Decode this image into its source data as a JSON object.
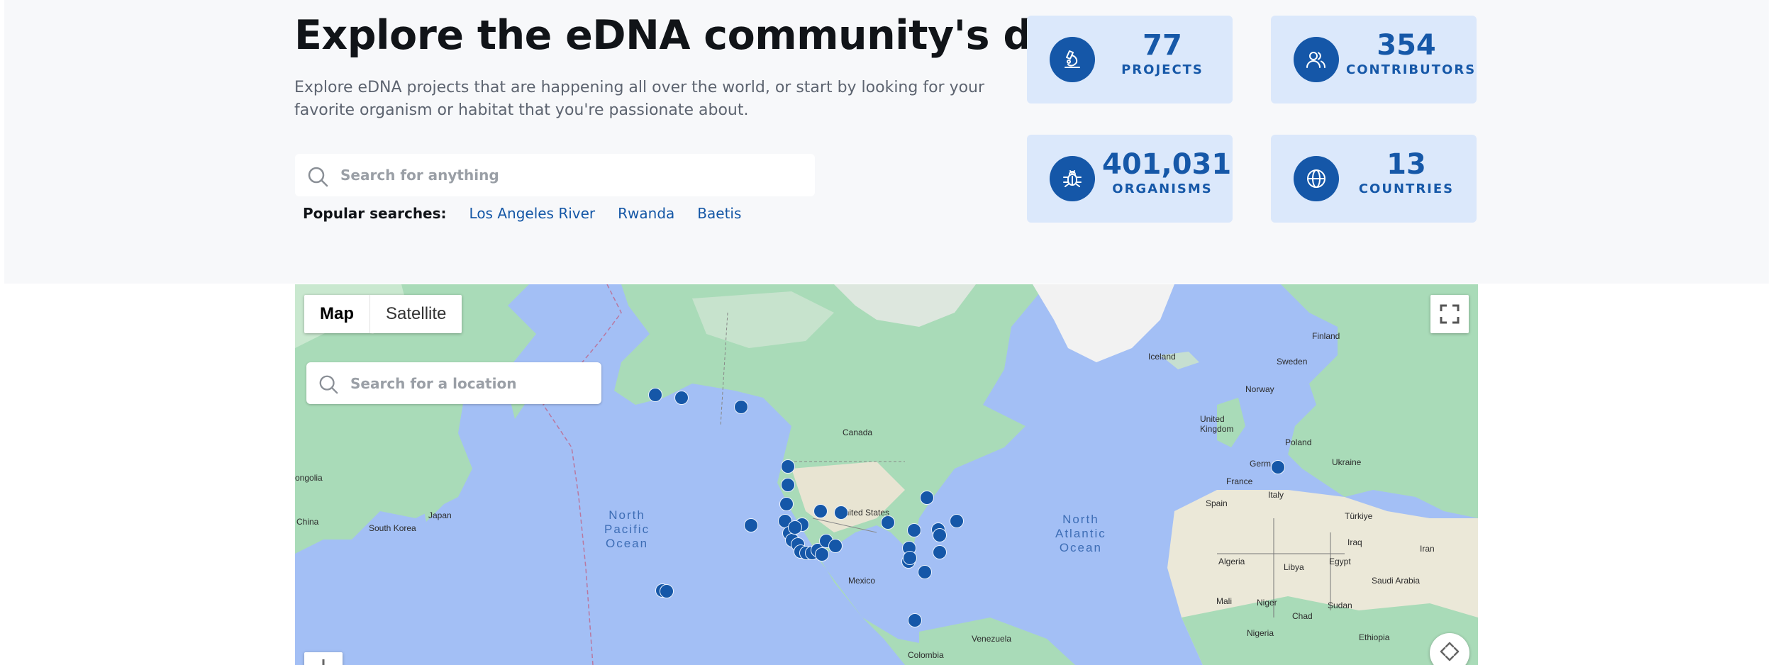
{
  "hero": {
    "title": "Explore the eDNA community's data",
    "subtitle": "Explore eDNA projects that are happening all over the world, or start by looking for your favorite organism or habitat that you're passionate about.",
    "search_placeholder": "Search for anything",
    "popular_label": "Popular searches:",
    "popular_links": [
      "Los Angeles River",
      "Rwanda",
      "Baetis"
    ]
  },
  "stats": [
    {
      "icon": "microscope-icon",
      "value": "77",
      "label": "PROJECTS"
    },
    {
      "icon": "users-icon",
      "value": "354",
      "label": "CONTRIBUTORS"
    },
    {
      "icon": "bug-icon",
      "value": "401,031",
      "label": "ORGANISMS"
    },
    {
      "icon": "globe-icon",
      "value": "13",
      "label": "COUNTRIES"
    }
  ],
  "colors": {
    "accent": "#1557a8",
    "stat_bg": "#dbe8fb",
    "hero_bg": "#f7f8fa",
    "link": "#1457a6",
    "ocean": "#a3bff5",
    "land": "#a9dbb8"
  },
  "map": {
    "type_options": [
      "Map",
      "Satellite"
    ],
    "selected_type": "Map",
    "search_placeholder": "Search for a location",
    "countries": {
      "finland": "Finland",
      "sweden": "Sweden",
      "iceland": "Iceland",
      "norway": "Norway",
      "united_kingdom": "United\nKingdom",
      "poland": "Poland",
      "ukraine": "Ukraine",
      "germany": "Germ",
      "france": "France",
      "italy": "Italy",
      "spain": "Spain",
      "turkiye": "Türkiye",
      "iraq": "Iraq",
      "iran": "Iran",
      "algeria": "Algeria",
      "libya": "Libya",
      "egypt": "Egypt",
      "saudi_arabia": "Saudi Arabia",
      "mali": "Mali",
      "niger": "Niger",
      "chad": "Chad",
      "sudan": "Sudan",
      "nigeria": "Nigeria",
      "ethiopia": "Ethiopia",
      "canada": "Canada",
      "united_states": "United States",
      "mexico": "Mexico",
      "venezuela": "Venezuela",
      "colombia": "Colombia",
      "mongolia": "ongolia",
      "china": "China",
      "south_korea": "South Korea",
      "japan": "Japan"
    },
    "oceans": {
      "north_pacific": "North\nPacific\nOcean",
      "north_atlantic": "North\nAtlantic\nOcean"
    },
    "project_marker_count": 37
  }
}
